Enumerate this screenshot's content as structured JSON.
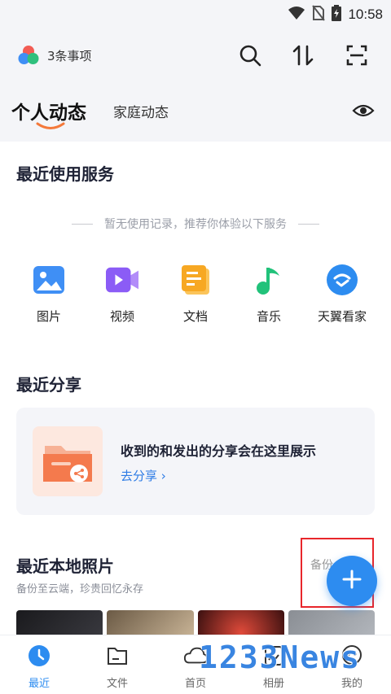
{
  "status_bar": {
    "time": "10:58"
  },
  "header": {
    "tasks": "3条事项"
  },
  "tabs": {
    "active": "个人动态",
    "inactive": "家庭动态"
  },
  "recent_services": {
    "title": "最近使用服务",
    "empty_text": "暂无使用记录，推荐你体验以下服务",
    "items": [
      {
        "label": "图片",
        "icon": "image-icon",
        "color": "#3f8ff5"
      },
      {
        "label": "视频",
        "icon": "video-icon",
        "color": "#8b5cf6"
      },
      {
        "label": "文档",
        "icon": "document-icon",
        "color": "#f7a823"
      },
      {
        "label": "音乐",
        "icon": "music-icon",
        "color": "#21c27a"
      },
      {
        "label": "天翼看家",
        "icon": "home-camera-icon",
        "color": "#2d8cf0"
      }
    ]
  },
  "recent_share": {
    "title": "最近分享",
    "message": "收到的和发出的分享会在这里展示",
    "link": "去分享 ›"
  },
  "recent_photos": {
    "title": "最近本地照片",
    "subtitle": "备份至云端，珍贵回忆永存",
    "backup": "备份"
  },
  "bottom_nav": [
    {
      "label": "最近",
      "icon": "clock-icon",
      "active": true
    },
    {
      "label": "文件",
      "icon": "folder-icon",
      "active": false
    },
    {
      "label": "首页",
      "icon": "cloud-icon",
      "active": false
    },
    {
      "label": "相册",
      "icon": "album-icon",
      "active": false
    },
    {
      "label": "我的",
      "icon": "profile-icon",
      "active": false
    }
  ],
  "watermark": "1233News",
  "colors": {
    "accent": "#2d8cf0",
    "highlight": "#e8262b"
  }
}
